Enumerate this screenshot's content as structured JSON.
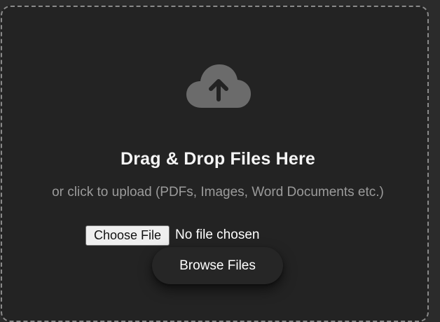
{
  "upload": {
    "icon": "cloud-upload-icon",
    "title": "Drag & Drop Files Here",
    "subtitle": "or click to upload (PDFs, Images, Word Documents etc.)",
    "choose_file_label": "Choose File",
    "file_status": "No file chosen",
    "browse_label": "Browse Files"
  },
  "colors": {
    "background": "#232323",
    "border": "#8a8a8a",
    "icon": "#6b6b6b",
    "title": "#f5f5f5",
    "subtitle": "#9b9b9b"
  }
}
